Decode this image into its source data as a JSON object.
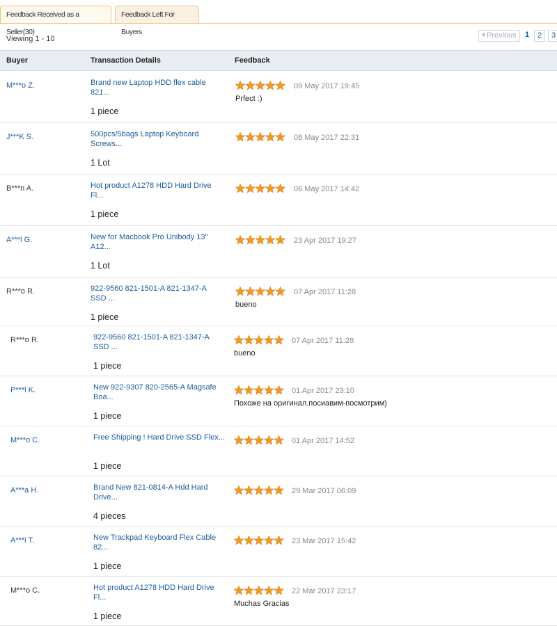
{
  "tabs": [
    {
      "label": "Feedback Received as a Seller(30)",
      "active": true
    },
    {
      "label": "Feedback Left For Buyers",
      "active": false
    }
  ],
  "viewing": "Viewing 1 - 10",
  "pager": {
    "previous": "Previous",
    "pages": [
      "1",
      "2",
      "3"
    ],
    "current": "1"
  },
  "columns": {
    "buyer": "Buyer",
    "details": "Transaction Details",
    "feedback": "Feedback"
  },
  "colors": {
    "link": "#1a5b9c",
    "star": "#f39a1e",
    "header_bg": "#e9edf4"
  },
  "rows": [
    {
      "buyer": "M***o Z.",
      "buyer_link": true,
      "product": "Brand new Laptop HDD flex cable 821...",
      "qty": "1 piece",
      "rating": 5,
      "date": "09 May 2017 19:45",
      "comment": "Prfect :)"
    },
    {
      "buyer": "J***K S.",
      "buyer_link": true,
      "product": "500pcs/5bags Laptop Keyboard Screws...",
      "qty": "1 Lot",
      "rating": 5,
      "date": "08 May 2017 22:31",
      "comment": ""
    },
    {
      "buyer": "B***n A.",
      "buyer_link": false,
      "product": "Hot product A1278 HDD Hard Drive Fl...",
      "qty": "1 piece",
      "rating": 5,
      "date": "06 May 2017 14:42",
      "comment": ""
    },
    {
      "buyer": "A***l G.",
      "buyer_link": true,
      "product": "New for Macbook Pro Unibody 13\" A12...",
      "qty": "1 Lot",
      "rating": 5,
      "date": "23 Apr 2017 19:27",
      "comment": ""
    },
    {
      "buyer": "R***o R.",
      "buyer_link": false,
      "product": "922-9560 821-1501-A 821-1347-A SSD ...",
      "qty": "1 piece",
      "rating": 5,
      "date": "07 Apr 2017 11:28",
      "comment": "bueno"
    },
    {
      "buyer": "R***o R.",
      "buyer_link": false,
      "product": "922-9560 821-1501-A 821-1347-A SSD ...",
      "qty": "1 piece",
      "rating": 5,
      "date": "07 Apr 2017 11:28",
      "comment": "bueno"
    },
    {
      "buyer": "P***l K.",
      "buyer_link": true,
      "product": "New 922-9307 820-2565-A Magsafe Boa...",
      "qty": "1 piece",
      "rating": 5,
      "date": "01 Apr 2017 23:10",
      "comment": "Похоже на оригинал.посиавим-посмотрим)"
    },
    {
      "buyer": "M***o C.",
      "buyer_link": true,
      "product": "Free Shipping ! Hard Drive SSD Flex...",
      "qty": "1 piece",
      "rating": 5,
      "date": "01 Apr 2017 14:52",
      "comment": ""
    },
    {
      "buyer": "A***a H.",
      "buyer_link": true,
      "product": "Brand New 821-0814-A Hdd Hard Drive...",
      "qty": "4 pieces",
      "rating": 5,
      "date": "29 Mar 2017 06:09",
      "comment": ""
    },
    {
      "buyer": "A***i T.",
      "buyer_link": true,
      "product": "New Trackpad Keyboard Flex Cable 82...",
      "qty": "1 piece",
      "rating": 5,
      "date": "23 Mar 2017 15:42",
      "comment": ""
    },
    {
      "buyer": "M***o C.",
      "buyer_link": false,
      "product": "Hot product A1278 HDD Hard Drive Fl...",
      "qty": "1 piece",
      "rating": 5,
      "date": "22 Mar 2017 23:17",
      "comment": "Muchas Gracias"
    }
  ]
}
